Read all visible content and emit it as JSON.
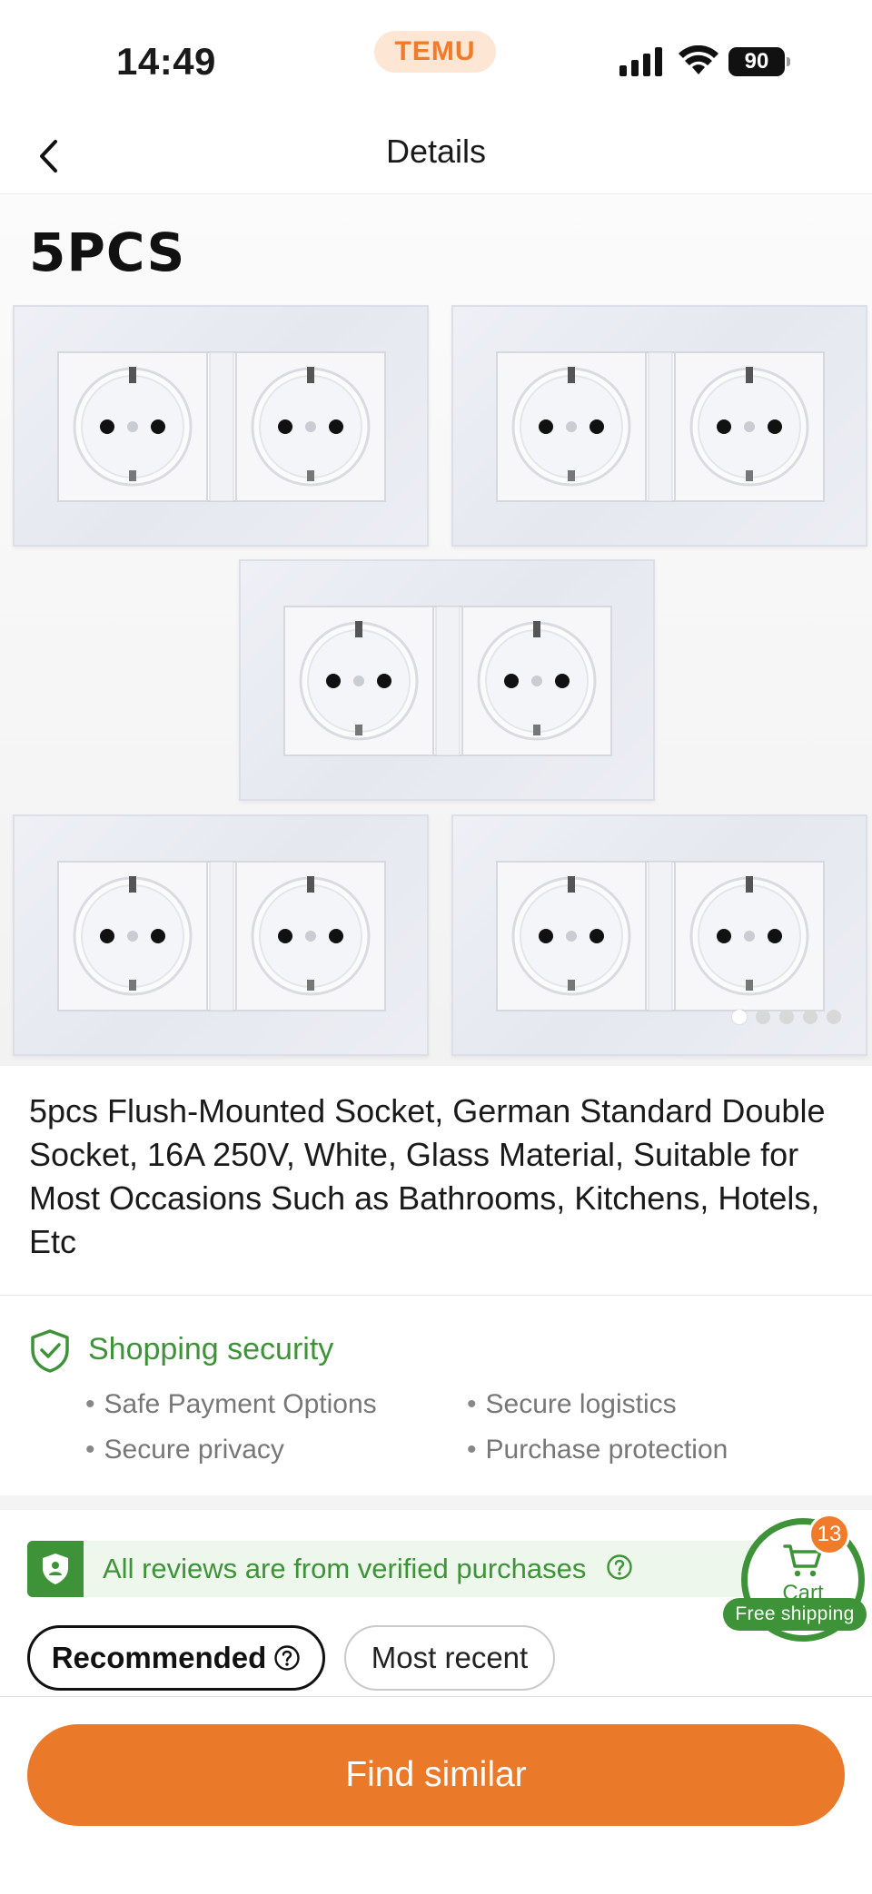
{
  "status_bar": {
    "time": "14:49",
    "brand": "TEMU",
    "battery": "90"
  },
  "nav": {
    "title": "Details"
  },
  "gallery": {
    "label": "5PCS",
    "image_count": 5,
    "active_index": 0
  },
  "product": {
    "title": "5pcs Flush-Mounted Socket, German Standard Double Socket, 16A 250V, White, Glass Material, Suitable for Most Occasions Such as Bathrooms, Kitchens, Hotels, Etc"
  },
  "security": {
    "title": "Shopping security",
    "items": [
      "Safe Payment Options",
      "Secure logistics",
      "Secure privacy",
      "Purchase protection"
    ]
  },
  "reviews": {
    "verified_text": "All reviews are from verified purchases",
    "filters": [
      "Recommended",
      "Most recent"
    ]
  },
  "cart": {
    "label": "Cart",
    "count": "13",
    "free_shipping": "Free shipping"
  },
  "actions": {
    "find_similar": "Find similar"
  },
  "colors": {
    "brand_orange": "#ea7a2a",
    "security_green": "#3e9339"
  },
  "icons": [
    "back-chevron-icon",
    "signal-icon",
    "wifi-icon",
    "battery-icon",
    "shield-check-icon",
    "verified-shield-icon",
    "question-circle-icon",
    "cart-icon"
  ]
}
